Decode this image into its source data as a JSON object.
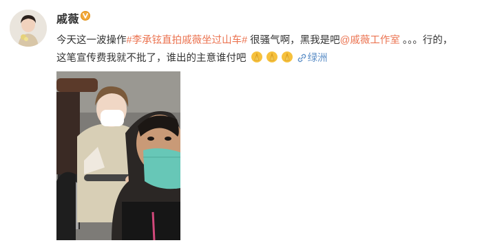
{
  "post": {
    "author": "戚薇",
    "verified_icon": "verified-badge-icon",
    "text_intro": "今天这一波操作",
    "hashtag": "#李承铉直拍戚薇坐过山车#",
    "text_mid": " 很骚气啊，黑我是吧",
    "mention": "@戚薇工作室",
    "text_after_mention": " 。。。行的，",
    "text_line2": "这笔宣传费我就不批了，谁出的主意谁付吧",
    "emojis": [
      "pray-emoji",
      "pray-emoji",
      "pray-emoji"
    ],
    "location": "绿洲",
    "location_icon": "link-icon",
    "colors": {
      "link": "#eb7350",
      "location": "#5d8fc7",
      "verified": "#f2a83a"
    }
  }
}
